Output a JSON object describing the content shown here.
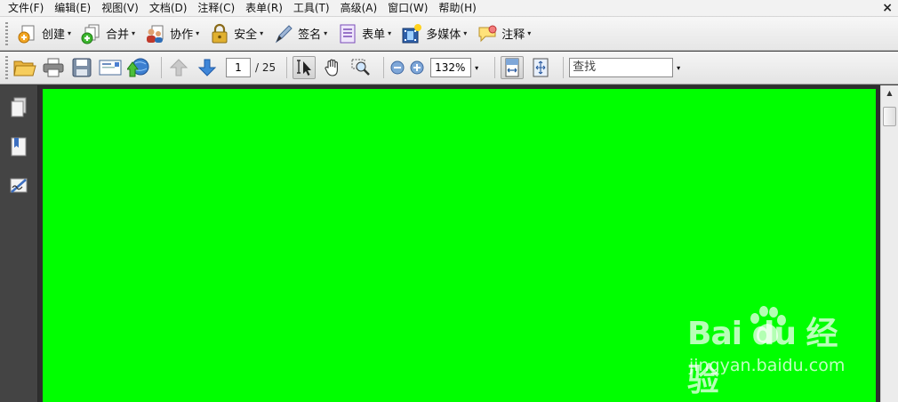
{
  "menu": {
    "items": [
      "文件(F)",
      "编辑(E)",
      "视图(V)",
      "文档(D)",
      "注释(C)",
      "表单(R)",
      "工具(T)",
      "高级(A)",
      "窗口(W)",
      "帮助(H)"
    ],
    "close_glyph": "×"
  },
  "task_toolbar": {
    "buttons": [
      {
        "label": "创建",
        "icon": "create-icon"
      },
      {
        "label": "合并",
        "icon": "combine-icon"
      },
      {
        "label": "协作",
        "icon": "collaborate-icon"
      },
      {
        "label": "安全",
        "icon": "lock-icon"
      },
      {
        "label": "签名",
        "icon": "pen-icon"
      },
      {
        "label": "表单",
        "icon": "form-icon"
      },
      {
        "label": "多媒体",
        "icon": "multimedia-icon"
      },
      {
        "label": "注释",
        "icon": "comment-icon"
      }
    ],
    "caret": "▾"
  },
  "nav_toolbar": {
    "current_page": "1",
    "total_pages": "/ 25",
    "zoom": "132%",
    "search_placeholder": "查找"
  },
  "watermark": {
    "logo": "Bai du 经验",
    "url": "jingyan.baidu.com"
  },
  "colors": {
    "page_fill": "#00ff00",
    "workspace": "#2e2e2e"
  }
}
